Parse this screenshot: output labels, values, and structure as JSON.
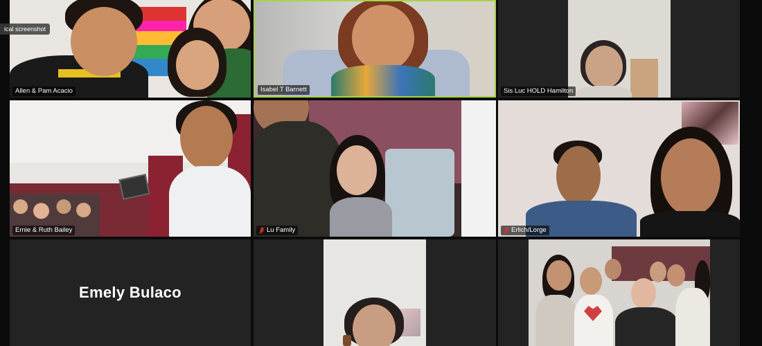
{
  "tooltip": "ical screenshot",
  "participants": [
    {
      "name": "Allen & Pam Acacio",
      "muted": false
    },
    {
      "name": "Isabel T Barnett",
      "muted": false
    },
    {
      "name": "Sis Luc   HOLD Hamilton",
      "muted": false
    },
    {
      "name": "Ernie & Ruth Bailey",
      "muted": false
    },
    {
      "name": "Lu Family",
      "muted": true
    },
    {
      "name": "Erlich/Lorge",
      "muted": true
    },
    {
      "name": "Emely Bulaco",
      "muted": false
    },
    {
      "name": "",
      "muted": false
    },
    {
      "name": "",
      "muted": false
    }
  ],
  "colors": {
    "active_speaker_border": "#a9d24a",
    "mute_icon": "#e0312b",
    "tile_background": "#232323"
  },
  "icons": {
    "muted": "microphone-off-icon"
  }
}
